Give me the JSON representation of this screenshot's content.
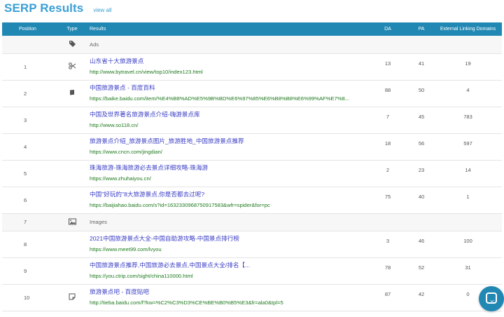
{
  "header": {
    "title": "SERP Results",
    "view_all": "view all"
  },
  "columns": {
    "position": "Position",
    "type": "Type",
    "results": "Results",
    "da": "DA",
    "pa": "PA",
    "eld": "External Linking Domains"
  },
  "rows": [
    {
      "kind": "sub",
      "position": "",
      "icon": "tag-icon",
      "label": "Ads"
    },
    {
      "kind": "link",
      "position": "1",
      "icon": "scissors-icon",
      "title": "山东省十大旅游景点",
      "url": "http://www.bytravel.cn/view/top10/index123.html",
      "da": "13",
      "pa": "41",
      "eld": "19"
    },
    {
      "kind": "link",
      "position": "2",
      "icon": "book-icon",
      "title": "中国旅游景点 - 百度百科",
      "url": "https://baike.baidu.com/item/%E4%B8%AD%E5%9B%BD%E6%97%85%E6%B8%B8%E6%99%AF%E7%8...",
      "da": "88",
      "pa": "50",
      "eld": "4"
    },
    {
      "kind": "link",
      "position": "3",
      "icon": "",
      "title": "中国及世界著名旅游景点介绍-嗨游景点库",
      "url": "http://www.so118.cn/",
      "da": "7",
      "pa": "45",
      "eld": "783"
    },
    {
      "kind": "link",
      "position": "4",
      "icon": "",
      "title": "旅游景点介绍_旅游景点图片_旅游胜地_中国旅游景点推荐",
      "url": "https://www.cncn.com/jingdian/",
      "da": "18",
      "pa": "56",
      "eld": "597"
    },
    {
      "kind": "link",
      "position": "5",
      "icon": "",
      "title": "珠海旅游-珠海旅游必去景点详细攻略-珠海游",
      "url": "https://www.zhuhaiyou.cn/",
      "da": "2",
      "pa": "23",
      "eld": "14"
    },
    {
      "kind": "link",
      "position": "6",
      "icon": "",
      "title": "中国\"好玩的\"8大旅游景点,你是否都去过呢?",
      "url": "https://baijiahao.baidu.com/s?id=1632330968750917583&wfr=spider&for=pc",
      "da": "75",
      "pa": "40",
      "eld": "1"
    },
    {
      "kind": "sub",
      "position": "7",
      "icon": "image-icon",
      "label": "Images"
    },
    {
      "kind": "link",
      "position": "8",
      "icon": "",
      "title": "2021中国旅游景点大全-中国自助游攻略-中国景点排行榜",
      "url": "https://www.meet99.com/lvyou",
      "da": "3",
      "pa": "46",
      "eld": "100"
    },
    {
      "kind": "link",
      "position": "9",
      "icon": "",
      "title": "中国旅游景点推荐,中国旅游必去景点,中国景点大全/排名【...",
      "url": "https://you.ctrip.com/sight/china110000.html",
      "da": "78",
      "pa": "52",
      "eld": "31"
    },
    {
      "kind": "link",
      "position": "10",
      "icon": "note-icon",
      "title": "旅游景点吧 - 百度贴吧",
      "url": "http://tieba.baidu.com/f?kw=%C2%C3%D3%CE%BE%B0%B5%E3&fr=ala0&tpl=5",
      "da": "87",
      "pa": "42",
      "eld": "0"
    }
  ]
}
